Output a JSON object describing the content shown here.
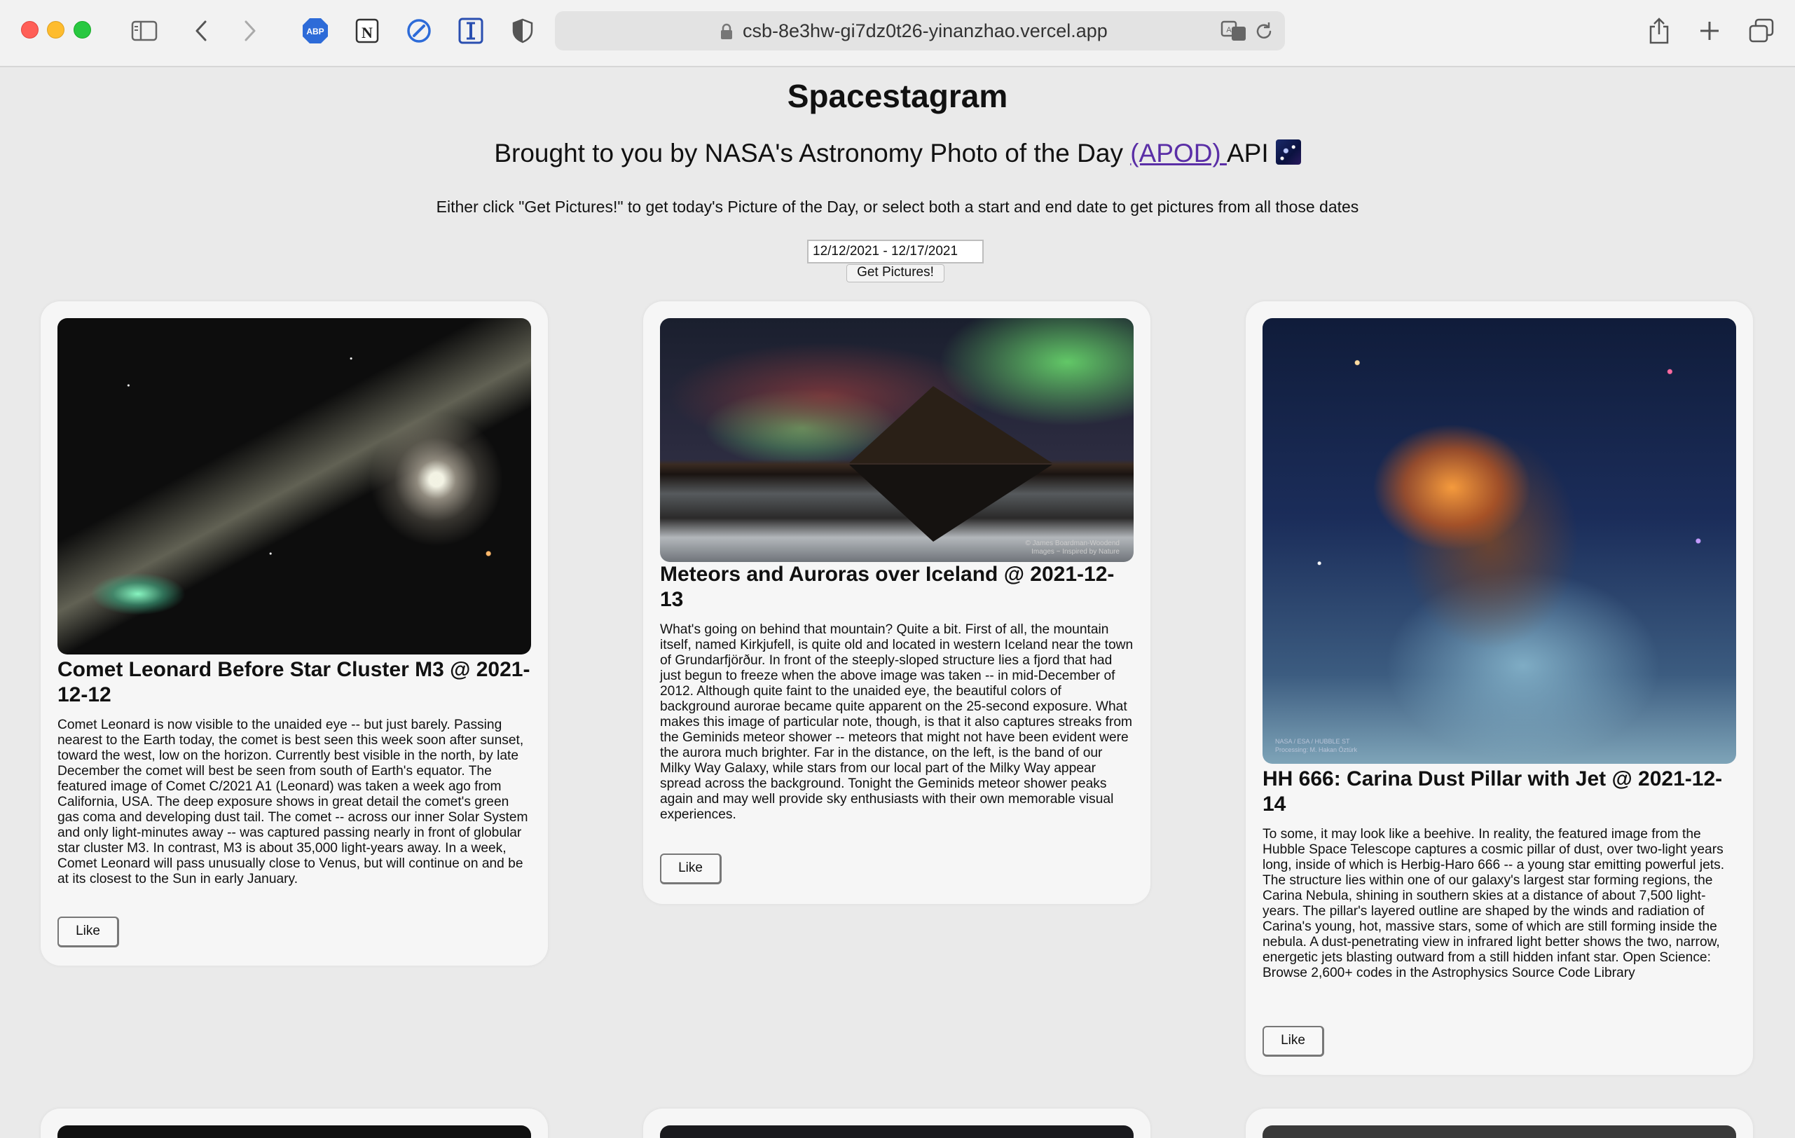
{
  "browser": {
    "url": "csb-8e3hw-gi7dz0t26-yinanzhao.vercel.app"
  },
  "page": {
    "title": "Spacestagram",
    "subtitle_prefix": "Brought to you by NASA's Astronomy Photo of the Day ",
    "subtitle_link": "(APOD) ",
    "subtitle_suffix": "API",
    "instructions": "Either click \"Get Pictures!\" to get today's Picture of the Day, or select both a start and end date to get pictures from all those dates",
    "date_range": "12/12/2021 - 12/17/2021",
    "get_button": "Get Pictures!"
  },
  "cards": [
    {
      "title": "Comet Leonard Before Star Cluster M3 @ 2021-12-12",
      "explanation": "Comet Leonard is now visible to the unaided eye -- but just barely. Passing nearest to the Earth today, the comet is best seen this week soon after sunset, toward the west, low on the horizon. Currently best visible in the north, by late December the comet will best be seen from south of Earth's equator. The featured image of Comet C/2021 A1 (Leonard) was taken a week ago from California, USA. The deep exposure shows in great detail the comet's green gas coma and developing dust tail. The comet -- across our inner Solar System and only light-minutes away -- was captured passing nearly in front of globular star cluster M3. In contrast, M3 is about 35,000 light-years away. In a week, Comet Leonard will pass unusually close to Venus, but will continue on and be at its closest to the Sun in early January.",
      "like": "Like"
    },
    {
      "title": "Meteors and Auroras over Iceland @ 2021-12-13",
      "explanation": "What's going on behind that mountain? Quite a bit. First of all, the mountain itself, named Kirkjufell, is quite old and located in western Iceland near the town of Grundarfjörður. In front of the steeply-sloped structure lies a fjord that had just begun to freeze when the above image was taken -- in mid-December of 2012. Although quite faint to the unaided eye, the beautiful colors of background aurorae became quite apparent on the 25-second exposure. What makes this image of particular note, though, is that it also captures streaks from the Geminids meteor shower -- meteors that might not have been evident were the aurora much brighter. Far in the distance, on the left, is the band of our Milky Way Galaxy, while stars from our local part of the Milky Way appear spread across the background. Tonight the Geminids meteor shower peaks again and may well provide sky enthusiasts with their own memorable visual experiences.",
      "photo_credit": "© James Boardman-Woodend\nImages ~ Inspired by Nature",
      "like": "Like"
    },
    {
      "title": "HH 666: Carina Dust Pillar with Jet @ 2021-12-14",
      "explanation": "To some, it may look like a beehive. In reality, the featured image from the Hubble Space Telescope captures a cosmic pillar of dust, over two-light years long, inside of which is Herbig-Haro 666 -- a young star emitting powerful jets. The structure lies within one of our galaxy's largest star forming regions, the Carina Nebula, shining in southern skies at a distance of about 7,500 light-years. The pillar's layered outline are shaped by the winds and radiation of Carina's young, hot, massive stars, some of which are still forming inside the nebula. A dust-penetrating view in infrared light better shows the two, narrow, energetic jets blasting outward from a still hidden infant star. Open Science: Browse 2,600+ codes in the Astrophysics Source Code Library",
      "photo_credit": "NASA / ESA / HUBBLE ST\nProcessing: M. Hakan Öztürk",
      "like": "Like"
    }
  ]
}
